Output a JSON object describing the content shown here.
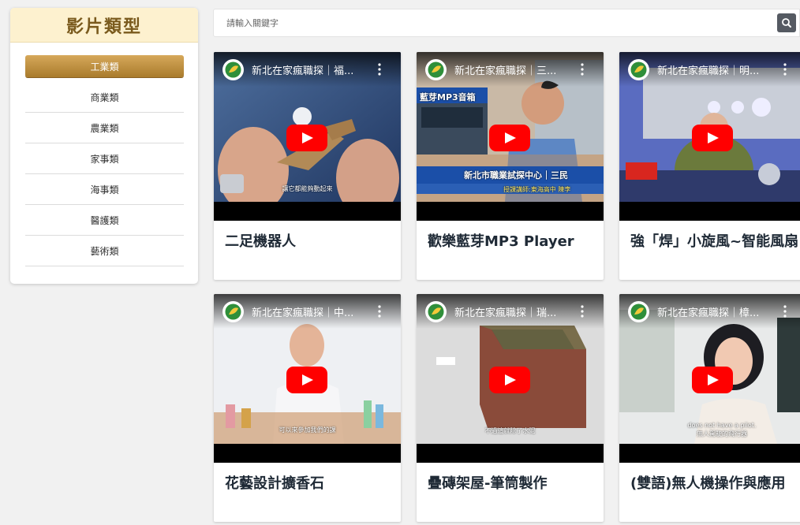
{
  "sidebar": {
    "title": "影片類型",
    "categories": [
      {
        "label": "工業類",
        "active": true
      },
      {
        "label": "商業類",
        "active": false
      },
      {
        "label": "農業類",
        "active": false
      },
      {
        "label": "家事類",
        "active": false
      },
      {
        "label": "海事類",
        "active": false
      },
      {
        "label": "醫護類",
        "active": false
      },
      {
        "label": "藝術類",
        "active": false
      }
    ]
  },
  "search": {
    "placeholder": "請輸入關鍵字",
    "value": ""
  },
  "videos": [
    {
      "yt_title": "新北在家瘋職探｜福...",
      "title": "二足機器人",
      "caption": "讓它都能夠動起來"
    },
    {
      "yt_title": "新北在家瘋職探｜三...",
      "title": "歡樂藍芽MP3 Player",
      "overlay_top": "藍芽MP3音箱",
      "overlay_banner": "新北市職業試探中心｜三民",
      "overlay_sub": "授課講師:東海高中 陳李"
    },
    {
      "yt_title": "新北在家瘋職探｜明...",
      "title": "強「焊」小旋風~智能風扇"
    },
    {
      "yt_title": "新北在家瘋職探｜中...",
      "title": "花藝設計擴香石",
      "caption": "可以來參加我們的課"
    },
    {
      "yt_title": "新北在家瘋職探｜瑞...",
      "title": "疊磚架屋-筆筒製作",
      "caption": "不過這就除了水泥"
    },
    {
      "yt_title": "新北在家瘋職探｜樟...",
      "title": "(雙語)無人機操作與應用",
      "caption": "does not have a pilot.",
      "caption2": "無人駕駛的飛行器"
    }
  ],
  "colors": {
    "accent_gold": "#b98a3b",
    "title_bg": "#fdf1cf",
    "title_text": "#7a5a1d",
    "youtube_red": "#ff0000"
  }
}
